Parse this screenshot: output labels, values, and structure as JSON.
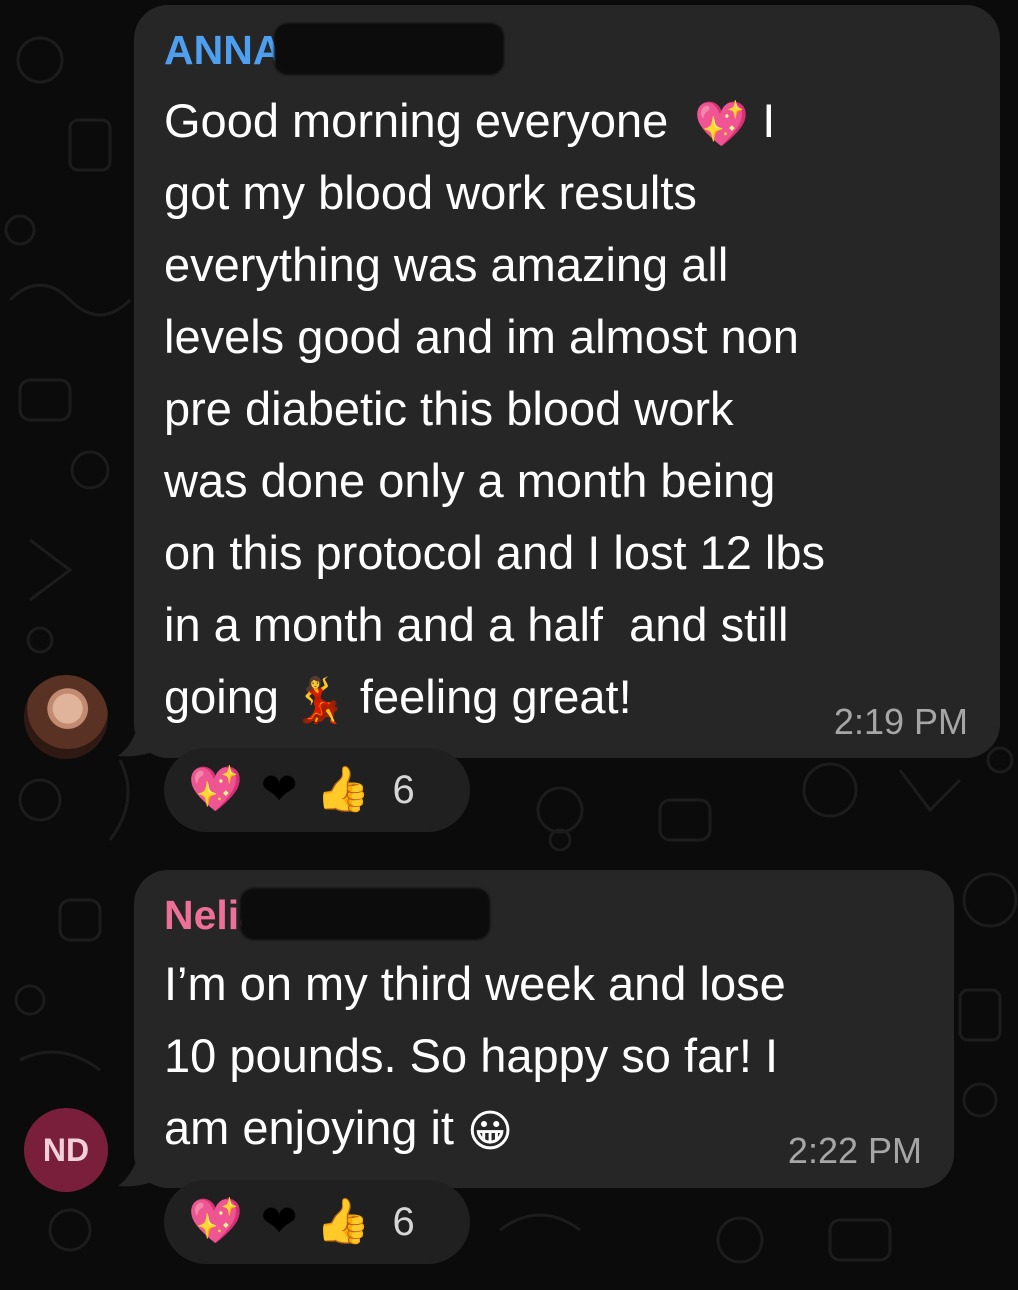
{
  "messages": [
    {
      "sender": "ANNA BASSO",
      "sender_color": "#4f9ff0",
      "avatar": "profile-photo",
      "lines": [
        "Good morning everyone",
        "got my blood work results",
        "everything was amazing all",
        "levels good and im almost non",
        "pre diabetic this blood work",
        "was done only a month being",
        "on this protocol and I lost 12 lbs",
        "in a month and a half  and still",
        "going",
        "feeling great!"
      ],
      "line1_tail": "I",
      "time": "2:19 PM",
      "reactions": {
        "count": "6"
      }
    },
    {
      "sender": "Nelia Dilena",
      "sender_color": "#ee6f97",
      "avatar_initials": "ND",
      "avatar_color": "#7a1f3b",
      "lines": [
        "I’m on my third week and lose",
        "10 pounds. So happy so far! I",
        "am enjoying it"
      ],
      "time": "2:22 PM",
      "reactions": {
        "count": "6"
      }
    }
  ],
  "emoji_names": [
    "sparkling-heart",
    "red-heart",
    "thumbs-up",
    "dancing-woman",
    "grinning-face"
  ]
}
